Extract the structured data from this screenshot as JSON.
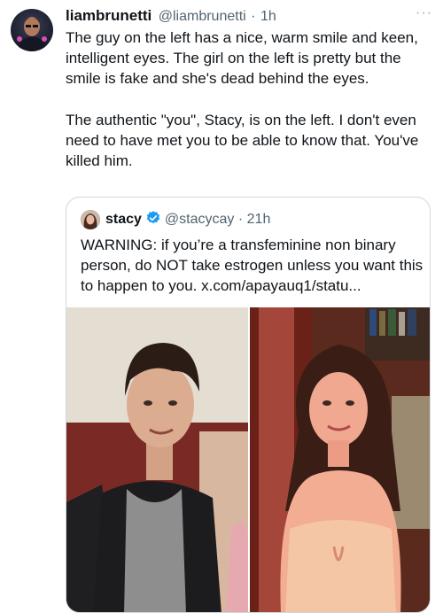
{
  "tweet": {
    "display_name": "liambrunetti",
    "handle": "@liambrunetti",
    "separator": "·",
    "time": "1h",
    "more_label": "···",
    "paragraph1": "The guy on the left has a nice, warm smile and keen, intelligent eyes. The girl on the left is pretty but the smile is fake and she's dead behind the eyes.",
    "paragraph2": "The authentic \"you\", Stacy, is on the left. I don't even need to have met you to be able to know that. You've killed him."
  },
  "quote": {
    "display_name": "stacy",
    "verified_icon": "verified-badge-icon",
    "handle": "@stacycay",
    "separator": "·",
    "time": "21h",
    "text": "WARNING: if you’re a transfeminine non binary person, do NOT take estrogen unless you want this to happen to you. x.com/apayauq1/statu...",
    "photos": [
      "photo-left",
      "photo-right"
    ]
  },
  "colors": {
    "text": "#0f1419",
    "secondary": "#536471",
    "border": "#cfd9de",
    "verified": "#1d9bf0"
  }
}
